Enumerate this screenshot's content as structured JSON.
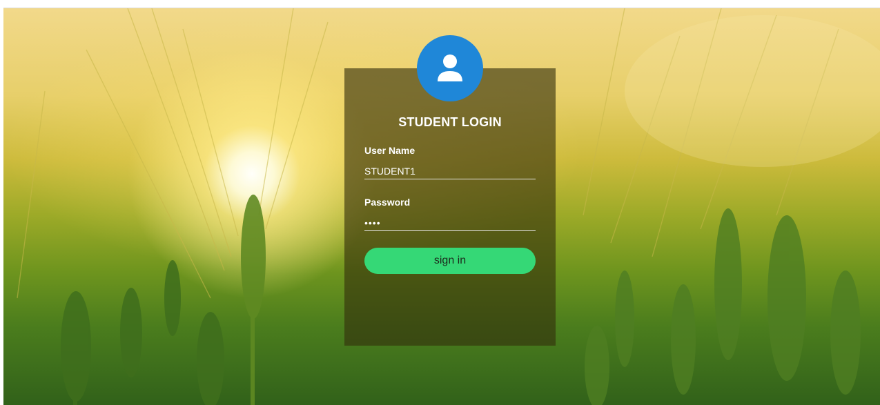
{
  "login": {
    "title": "STUDENT LOGIN",
    "username_label": "User Name",
    "username_value": "STUDENT1",
    "password_label": "Password",
    "password_value": "••••",
    "signin_label": "sign in"
  },
  "colors": {
    "avatar": "#1f87d8",
    "signin_button": "#35d876",
    "panel": "rgba(52,46,12,0.62)"
  },
  "icons": {
    "avatar": "user-icon"
  }
}
